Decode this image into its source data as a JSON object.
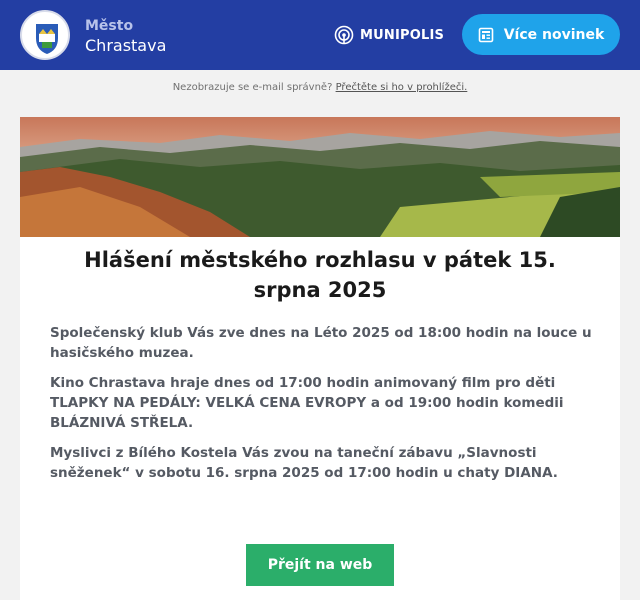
{
  "header": {
    "town_prefix": "Město",
    "town_name": "Chrastava",
    "brand": "MUNIPOLIS",
    "news_button": "Více novinek"
  },
  "notice": {
    "text": "Nezobrazuje se e-mail správně?",
    "link": "Přečtěte si ho v prohlížeči."
  },
  "article": {
    "title": "Hlášení městského rozhlasu v pátek 15. srpna 2025",
    "paragraphs": [
      "Společenský klub Vás zve dnes na Léto 2025 od 18:00 hodin na louce u hasičského muzea.",
      "Kino Chrastava hraje dnes od 17:00 hodin animovaný film pro děti TLAPKY NA PEDÁLY: VELKÁ CENA EVROPY a od 19:00 hodin komedii BLÁZNIVÁ STŘELA.",
      "Myslivci z Bílého Kostela Vás zvou na taneční zábavu „Slavnosti sněženek“ v sobotu 16. srpna 2025 od 17:00 hodin u chaty DIANA."
    ],
    "cta": "Přejít na web"
  },
  "colors": {
    "header_bg": "#233ea3",
    "news_button_bg": "#1fa3ea",
    "cta_bg": "#2bae6a",
    "page_bg": "#f2f2f2"
  },
  "icons": {
    "brand": "broadcast-icon",
    "news_button": "newspaper-icon"
  }
}
